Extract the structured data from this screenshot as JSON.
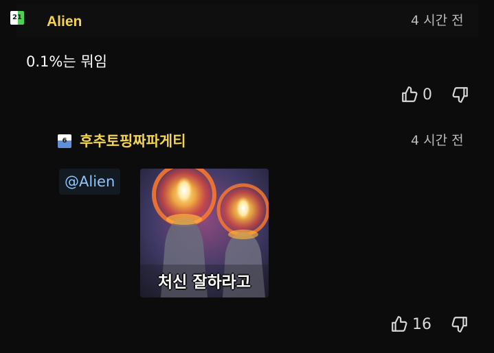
{
  "comment": {
    "level": "21",
    "username": "Alien",
    "timestamp": "4 시간 전",
    "body": "0.1%는 뭐임",
    "likes": "0"
  },
  "reply": {
    "level": "6",
    "username": "후추토핑짜파게티",
    "timestamp": "4 시간 전",
    "mention": "@Alien",
    "image_caption": "처신 잘하라고",
    "likes": "16"
  },
  "icons": {
    "like": "thumbs-up-icon",
    "dislike": "thumbs-down-icon"
  },
  "colors": {
    "background": "#0c0c0d",
    "username": "#f3d44c",
    "mention": "#8fc6ff",
    "timestamp": "#bdbdbd"
  }
}
